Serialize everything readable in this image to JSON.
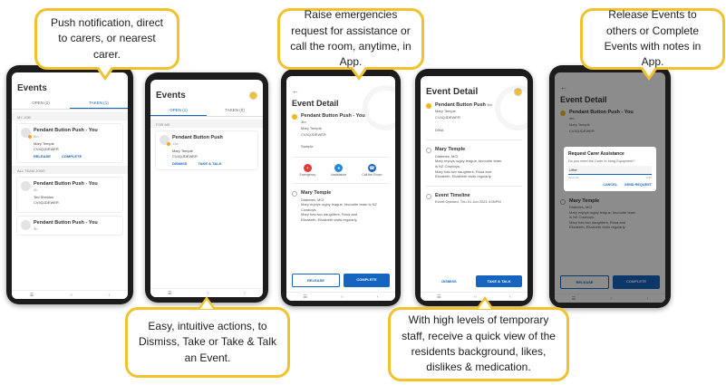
{
  "callouts": {
    "push": "Push notification, direct to carers, or nearest carer.",
    "raise": "Raise emergencies request for assistance or call the room, anytime, in App.",
    "release": "Release Events to others or Complete Events with notes in App.",
    "easy": "Easy, intuitive actions, to Dismiss, Take or Take & Talk an Event.",
    "staff": "With high levels of temporary staff, receive a quick view of the residents background, likes, dislikes & medication."
  },
  "phone1": {
    "title": "Events",
    "tabs": [
      "OPEN (2)",
      "TAKEN (1)"
    ],
    "section1": "MY JOB",
    "card1": {
      "title": "Pendant Button Push - You",
      "time": "5m",
      "person": "Mary Temple",
      "room": "CV4QJDEWER",
      "actions": [
        "RELEASE",
        "COMPLETE"
      ]
    },
    "section2": "ALL TEAM JOBS",
    "card2": {
      "title": "Pendant Button Push - You",
      "time": "3h",
      "person": "Ted Sheldon",
      "room": "CV4QJDEWER"
    },
    "card3": {
      "title": "Pendant Button Push - You",
      "time": "3h"
    }
  },
  "phone2": {
    "title": "Events",
    "tabs": [
      "OPEN (1)",
      "TAKEN (0)"
    ],
    "section": "FOR ME",
    "card": {
      "title": "Pendant Button Push",
      "time": "13s",
      "person": "Mary Temple",
      "room": "CV4QJDEWER",
      "actions": [
        "DISMISS",
        "TAKE & TALK"
      ]
    }
  },
  "phone3": {
    "title": "Event Detail",
    "event": {
      "title": "Pendant Button Push - You",
      "time": "3m",
      "person": "Mary Temple",
      "room": "CV4QJDEWER",
      "note": "Sample"
    },
    "emergency": [
      "Emergency",
      "Assistance",
      "Call the Room"
    ],
    "resident": {
      "name": "Mary Temple",
      "lines": [
        "Diabetes, MCI",
        "Mary enjoys rugby league, favourite team is NZ Cowboys.",
        "Mary has two daughters, Rosa and",
        "Elizabeth. Elizabeth visits regularly."
      ]
    },
    "buttons": [
      "RELEASE",
      "COMPLETE"
    ]
  },
  "phone4": {
    "title": "Event Detail",
    "event": {
      "title": "Pendant Button Push",
      "time": "5m",
      "person": "Mary Temple",
      "room": "CV4QJDEWER",
      "note": "DINA"
    },
    "resident": {
      "name": "Mary Temple",
      "lines": [
        "Diabetes, MCI",
        "Mary enjoys rugby league, favourite team",
        "is NZ Cowboys.",
        "Mary has two daughters, Rosa and",
        "Elizabeth. Elizabeth visits regularly."
      ]
    },
    "timeline": {
      "title": "Event Timeline",
      "line": "Event Opened, Thu 01 Jun 2021 4:05PM"
    },
    "buttons": [
      "DISMISS",
      "TAKE & TALK"
    ]
  },
  "phone5": {
    "title": "Event Detail",
    "event": {
      "title": "Pendant Button Push - You",
      "time": "4m",
      "person": "Mary Temple",
      "room": "CV4QJDEWER"
    },
    "dialog": {
      "title": "Request Carer Assistance",
      "question": "Do you need the Carer to bring Equipment?",
      "value": "Lifter",
      "optional": "Optional",
      "counter": "6/30",
      "cancel": "CANCEL",
      "send": "SEND REQUEST"
    },
    "resident": {
      "name": "Mary Temple",
      "lines": [
        "Diabetes, MCI",
        "Mary enjoys rugby league, favourite team",
        "is NZ Cowboys.",
        "Mary has two daughters, Rosa and",
        "Elizabeth. Elizabeth visits regularly."
      ]
    },
    "buttons": [
      "RELEASE",
      "COMPLETE"
    ]
  },
  "colors": {
    "accent": "#1565c0",
    "callout_border": "#f2c12e",
    "event_dot": "#f2b619",
    "emergency": "#e53935",
    "assistance": "#1e88e5",
    "call": "#1565c0"
  }
}
